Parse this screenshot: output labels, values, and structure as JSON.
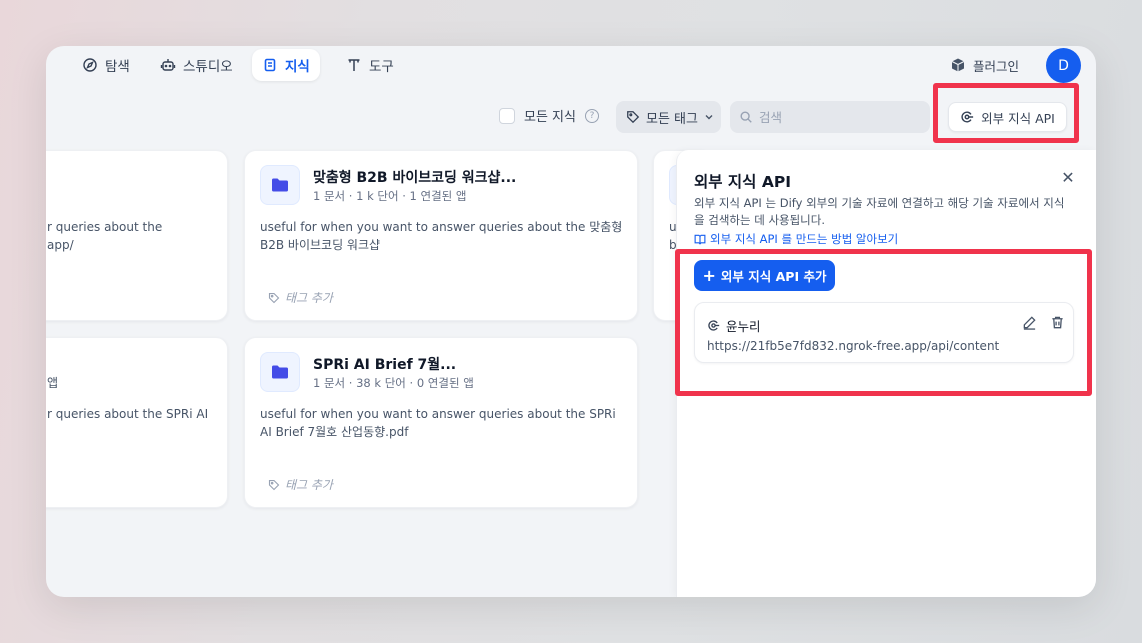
{
  "nav": {
    "tabs": [
      {
        "label": "탐색",
        "icon": "compass-icon"
      },
      {
        "label": "스튜디오",
        "icon": "robot-icon"
      },
      {
        "label": "지식",
        "icon": "book-icon",
        "active": true
      },
      {
        "label": "도구",
        "icon": "tool-icon"
      }
    ],
    "plugin_label": "플러그인",
    "avatar_initial": "D"
  },
  "toolbar": {
    "all_knowledge_label": "모든 지식",
    "all_tags_label": "모든 태그",
    "search_placeholder": "검색",
    "external_api_button": "외부 지식 API"
  },
  "cards": {
    "card1": {
      "title": "맞춤형 B2B 바이브코딩 워크샵...",
      "meta": "1 문서 · 1 k 단어 · 1 연결된 앱",
      "description": "useful for when you want to answer queries about the 맞춤형 B2B 바이브코딩 워크샵",
      "tag_placeholder": "태그 추가"
    },
    "card2": {
      "title": "SPRi AI Brief 7월...",
      "meta": "1 문서 · 38 k 단어 · 0 연결된 앱",
      "description": "useful for when you want to answer queries about the SPRi AI Brief 7월호 산업동향.pdf",
      "tag_placeholder": "태그 추가"
    },
    "left_partial_1": {
      "line1": "r queries about the",
      "line2": "app/"
    },
    "left_partial_2": {
      "line1": "앱",
      "line2": "r queries about the SPRi AI"
    },
    "right_partial": {
      "line1": "u",
      "line2": "b"
    }
  },
  "panel": {
    "title": "외부 지식 API",
    "description": "외부 지식 API 는 Dify 외부의 기술 자료에 연결하고 해당 기술 자료에서 지식을 검색하는 데 사용됩니다.",
    "link_text": "외부 지식 API 를 만드는 방법 알아보기",
    "add_button": "외부 지식 API 추가",
    "items": [
      {
        "name": "윤누리",
        "url": "https://21fb5e7fd832.ngrok-free.app/api/content"
      }
    ]
  },
  "colors": {
    "accent": "#155EEF",
    "highlight": "#F0334C"
  }
}
